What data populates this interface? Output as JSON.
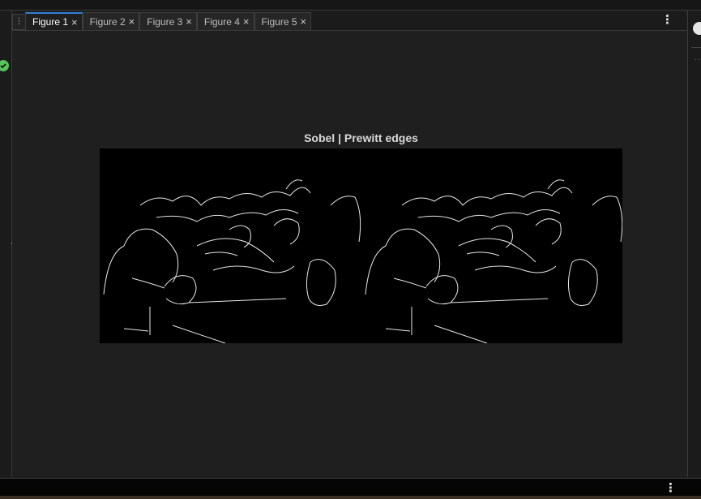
{
  "tabs": [
    {
      "label": "Figure 1",
      "active": true
    },
    {
      "label": "Figure 2",
      "active": false
    },
    {
      "label": "Figure 3",
      "active": false
    },
    {
      "label": "Figure 4",
      "active": false
    },
    {
      "label": "Figure 5",
      "active": false
    }
  ],
  "tab_close_glyph": "×",
  "tab_grip_glyph": "⋮",
  "tabbar_menu_glyph": "⋮",
  "bottom_menu_glyph": "⋮",
  "figure": {
    "title": "Sobel | Prewitt edges",
    "image_description": "two side-by-side black edge-detection panels with white outlines"
  },
  "colors": {
    "accent": "#2f7fd8",
    "status_ok": "#58c35a",
    "background": "#1f1f1f"
  },
  "icons": {
    "status": "check-circle-icon",
    "right_panel": "copilot-icon"
  }
}
